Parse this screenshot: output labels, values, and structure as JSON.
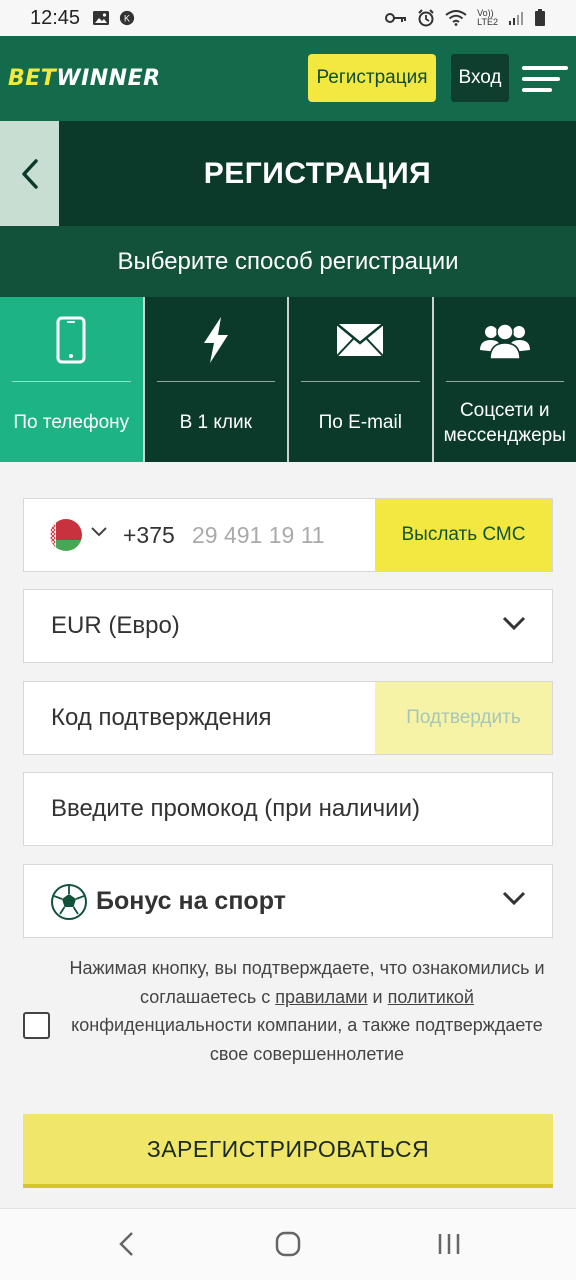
{
  "status_bar": {
    "time": "12:45",
    "network_label_top": "Vo))",
    "network_label_bottom": "LTE2"
  },
  "header": {
    "logo_part1": "BET",
    "logo_part2": "WINNER",
    "register_label": "Регистрация",
    "login_label": "Вход"
  },
  "page": {
    "title": "РЕГИСТРАЦИЯ",
    "subtitle": "Выберите способ регистрации"
  },
  "tabs": [
    {
      "label": "По телефону",
      "icon": "phone-icon",
      "active": true
    },
    {
      "label": "В 1 клик",
      "icon": "lightning-icon",
      "active": false
    },
    {
      "label": "По E-mail",
      "icon": "envelope-icon",
      "active": false
    },
    {
      "label": "Соцсети и мессенджеры",
      "icon": "users-icon",
      "active": false
    }
  ],
  "form": {
    "phone_code": "+375",
    "phone_placeholder": "29 491 19 11",
    "send_sms_label": "Выслать СМС",
    "currency_value": "EUR (Евро)",
    "code_placeholder": "Код подтверждения",
    "confirm_label": "Подтвердить",
    "promo_placeholder": "Введите промокод (при наличии)",
    "bonus_value": "Бонус на спорт",
    "agree_part1": "Нажимая кнопку, вы подтверждаете, что ознакомились и соглашаетесь с ",
    "agree_link1": "правилами",
    "agree_part2": " и ",
    "agree_link2": "политикой",
    "agree_part3": " конфиденциальности компании, а также подтверждаете свое совершеннолетие",
    "register_button_label": "ЗАРЕГИСТРИРОВАТЬСЯ"
  },
  "colors": {
    "header_bg": "#146b4b",
    "dark_green": "#0c3a2a",
    "accent_yellow": "#f3e83f",
    "active_tab": "#1db384"
  }
}
